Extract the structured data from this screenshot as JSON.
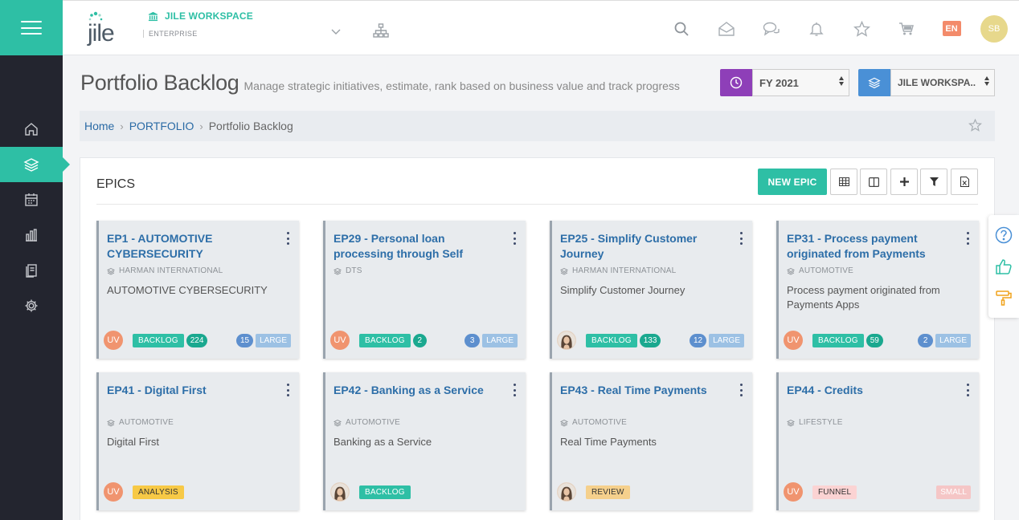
{
  "app": {
    "logo_text": "jile",
    "workspace_name": "JILE WORKSPACE",
    "workspace_type": "ENTERPRISE",
    "language": "EN",
    "user_initials": "SB"
  },
  "page": {
    "title": "Portfolio Backlog",
    "subtitle": "Manage strategic initiatives, estimate, rank based on business value and track progress",
    "year_select": "FY 2021",
    "workspace_select": "JILE WORKSPA.."
  },
  "breadcrumb": [
    "Home",
    "PORTFOLIO",
    "Portfolio Backlog"
  ],
  "panel": {
    "title": "EPICS",
    "new_button": "NEW EPIC"
  },
  "cards": [
    {
      "title": "EP1 - AUTOMOTIVE CYBERSECURITY",
      "org": "HARMAN INTERNATIONAL",
      "desc": "AUTOMOTIVE CYBERSECURITY",
      "avatar": "UV",
      "status": "BACKLOG",
      "count": "224",
      "points": "15",
      "size": "LARGE"
    },
    {
      "title": "EP29 - Personal loan processing through Self",
      "org": "DTS",
      "desc": "",
      "avatar": "UV",
      "status": "BACKLOG",
      "count": "2",
      "points": "3",
      "size": "LARGE"
    },
    {
      "title": "EP25 - Simplify Customer Journey",
      "org": "HARMAN INTERNATIONAL",
      "desc": "Simplify Customer Journey",
      "avatar": "photo",
      "status": "BACKLOG",
      "count": "133",
      "points": "12",
      "size": "LARGE"
    },
    {
      "title": "EP31 - Process payment originated from Payments",
      "org": "AUTOMOTIVE",
      "desc": "Process payment originated from Payments Apps",
      "avatar": "UV",
      "status": "BACKLOG",
      "count": "59",
      "points": "2",
      "size": "LARGE"
    },
    {
      "title": "EP41 - Digital First",
      "org": "AUTOMOTIVE",
      "desc": "Digital First",
      "avatar": "UV",
      "status": "ANALYSIS",
      "count": "",
      "points": "",
      "size": ""
    },
    {
      "title": "EP42 - Banking as a Service",
      "org": "AUTOMOTIVE",
      "desc": "Banking as a Service",
      "avatar": "photo",
      "status": "BACKLOG",
      "count": "",
      "points": "",
      "size": ""
    },
    {
      "title": "EP43 - Real Time Payments",
      "org": "AUTOMOTIVE",
      "desc": "Real Time Payments",
      "avatar": "photo",
      "status": "REVIEW",
      "count": "",
      "points": "",
      "size": ""
    },
    {
      "title": "EP44 - Credits",
      "org": "LIFESTYLE",
      "desc": "",
      "avatar": "UV",
      "status": "FUNNEL",
      "count": "",
      "points": "",
      "size": "SMALL"
    }
  ],
  "colors": {
    "accent": "#2ebfa5",
    "sidebar": "#23252f",
    "link": "#2d6ea8",
    "year_icon_bg": "#8e3fb8",
    "workspace_icon_bg": "#4a90d6"
  },
  "icons": {
    "sidebar": [
      "home-icon",
      "layers-icon",
      "calendar-icon",
      "bar-chart-icon",
      "clipboard-icon",
      "settings-icon"
    ],
    "topbar": [
      "search-icon",
      "inbox-icon",
      "chat-icon",
      "bell-icon",
      "star-icon",
      "cart-icon"
    ],
    "tools": [
      "grid-view-icon",
      "split-view-icon",
      "add-icon",
      "filter-icon",
      "excel-export-icon"
    ],
    "float": [
      "help-icon",
      "thumbs-up-icon",
      "paint-roller-icon"
    ]
  }
}
